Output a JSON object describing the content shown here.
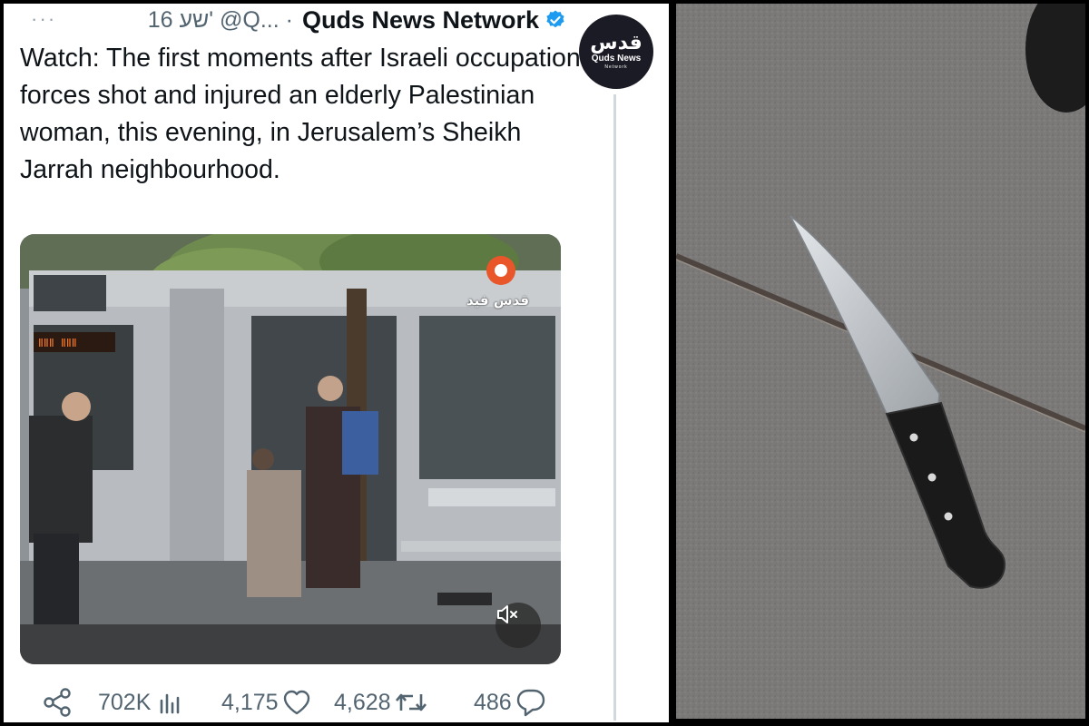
{
  "tweet": {
    "more_glyph": "· · ·",
    "time": "16 שע'",
    "handle": "@Q... ·",
    "display_name": "Quds News Network",
    "verified_icon": "verified-badge-icon",
    "verified_color": "#1d9bf0",
    "avatar": {
      "logo_arabic": "قدس",
      "logo_name": "Quds News",
      "logo_sub": "Network"
    },
    "text": "Watch: The first moments after Israeli occupation forces shot and injured an elderly Palestinian woman, this evening, in Jerusalem’s Sheikh Jarrah neighbourhood.",
    "media": {
      "type": "video",
      "watermark": "قدس فيد",
      "mute_icon": "speaker-muted-icon"
    },
    "actions": {
      "share_icon": "share-icon",
      "views": "702K",
      "views_icon": "analytics-bars-icon",
      "likes": "4,175",
      "likes_icon": "heart-icon",
      "reposts": "4,628",
      "reposts_icon": "repost-icon",
      "replies": "486",
      "replies_icon": "reply-bubble-icon"
    }
  },
  "photo": {
    "subject": "knife-on-pavement",
    "colors": {
      "pavement": "#7d7c7b",
      "blade": "#c9ccd0",
      "handle": "#1a1a1a"
    }
  },
  "colors": {
    "text_primary": "#0f1419",
    "text_secondary": "#536471",
    "background": "#ffffff",
    "border": "#000000"
  }
}
